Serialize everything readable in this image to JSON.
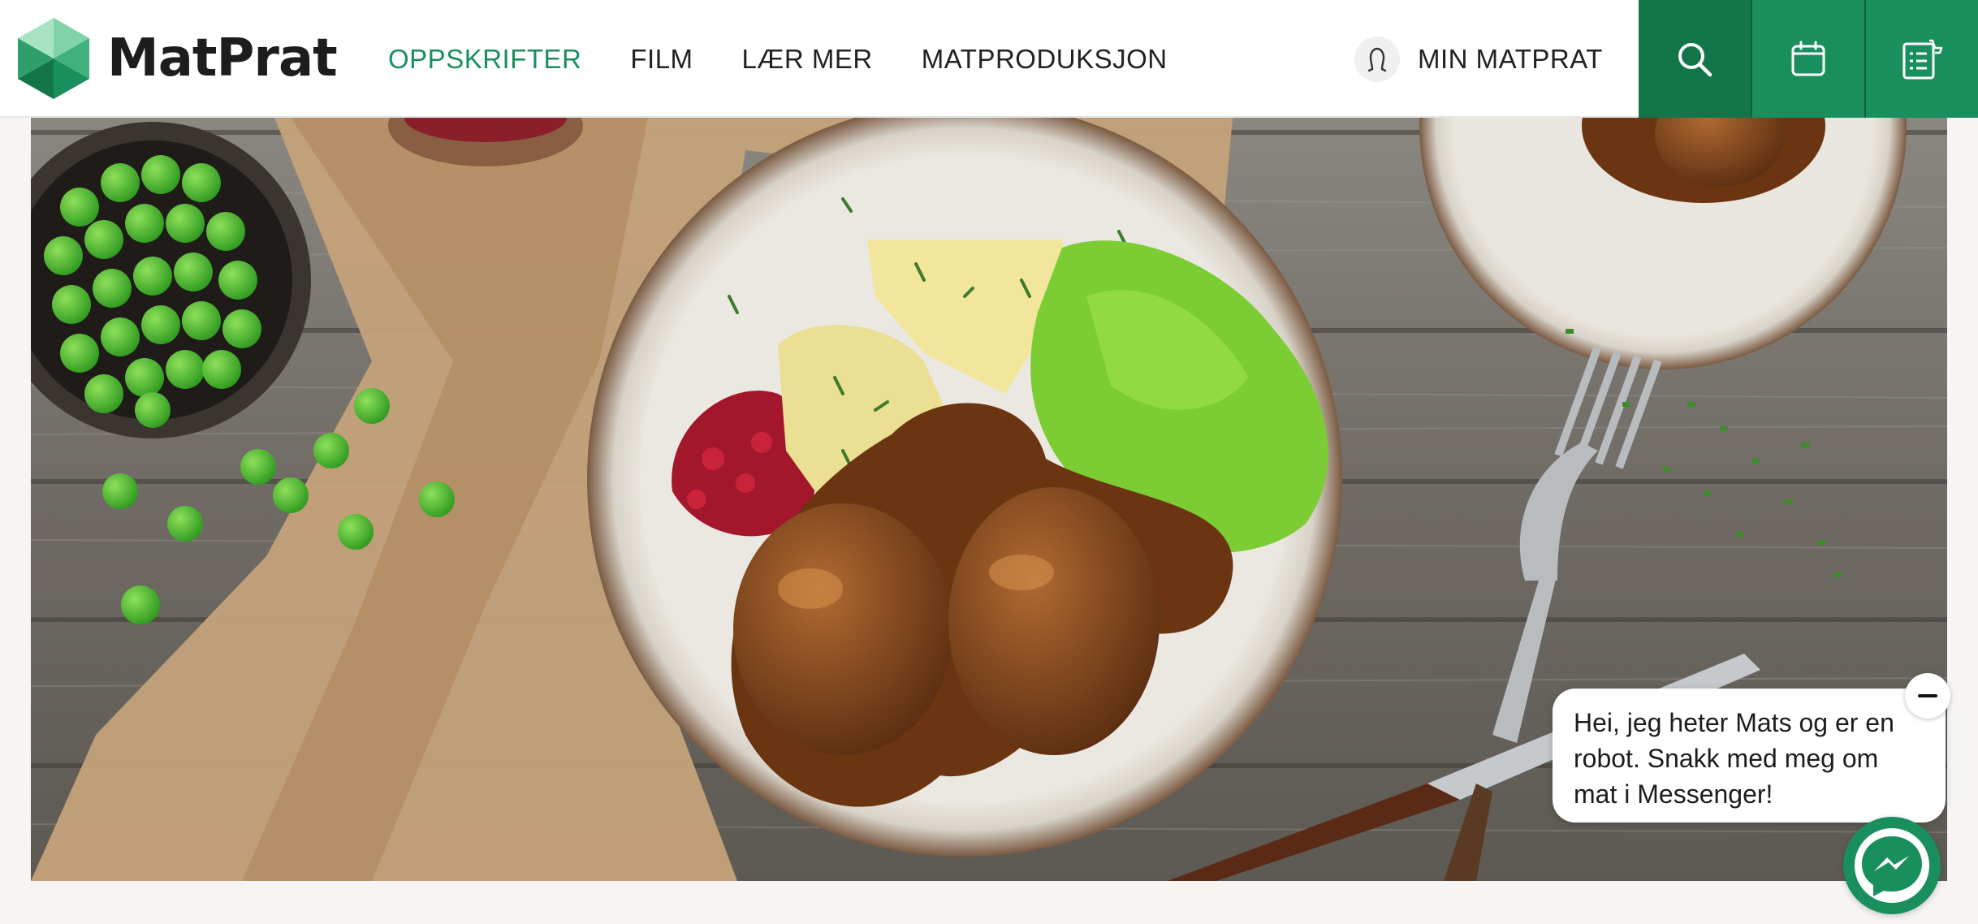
{
  "brand": {
    "name": "MatPrat",
    "logo_icon": "hexagon-logo-icon",
    "accent": "#1a8f5e",
    "accent_dark": "#13764b"
  },
  "nav": {
    "items": [
      {
        "label": "OPPSKRIFTER",
        "active": true
      },
      {
        "label": "FILM",
        "active": false
      },
      {
        "label": "LÆR MER",
        "active": false
      },
      {
        "label": "MATPRODUKSJON",
        "active": false
      }
    ]
  },
  "user": {
    "label": "MIN MATPRAT",
    "icon": "user-icon"
  },
  "actions": [
    {
      "name": "search",
      "icon": "search-icon"
    },
    {
      "name": "calendar",
      "icon": "calendar-icon"
    },
    {
      "name": "shopping-list",
      "icon": "shopping-list-icon"
    }
  ],
  "hero": {
    "image": "kjottkaker-med-erterstuing-photo"
  },
  "chat": {
    "message": "Hei, jeg heter Mats og er en robot. Snakk med meg om mat i Messenger!",
    "close_icon": "minimize-icon",
    "launcher_icon": "messenger-icon"
  }
}
